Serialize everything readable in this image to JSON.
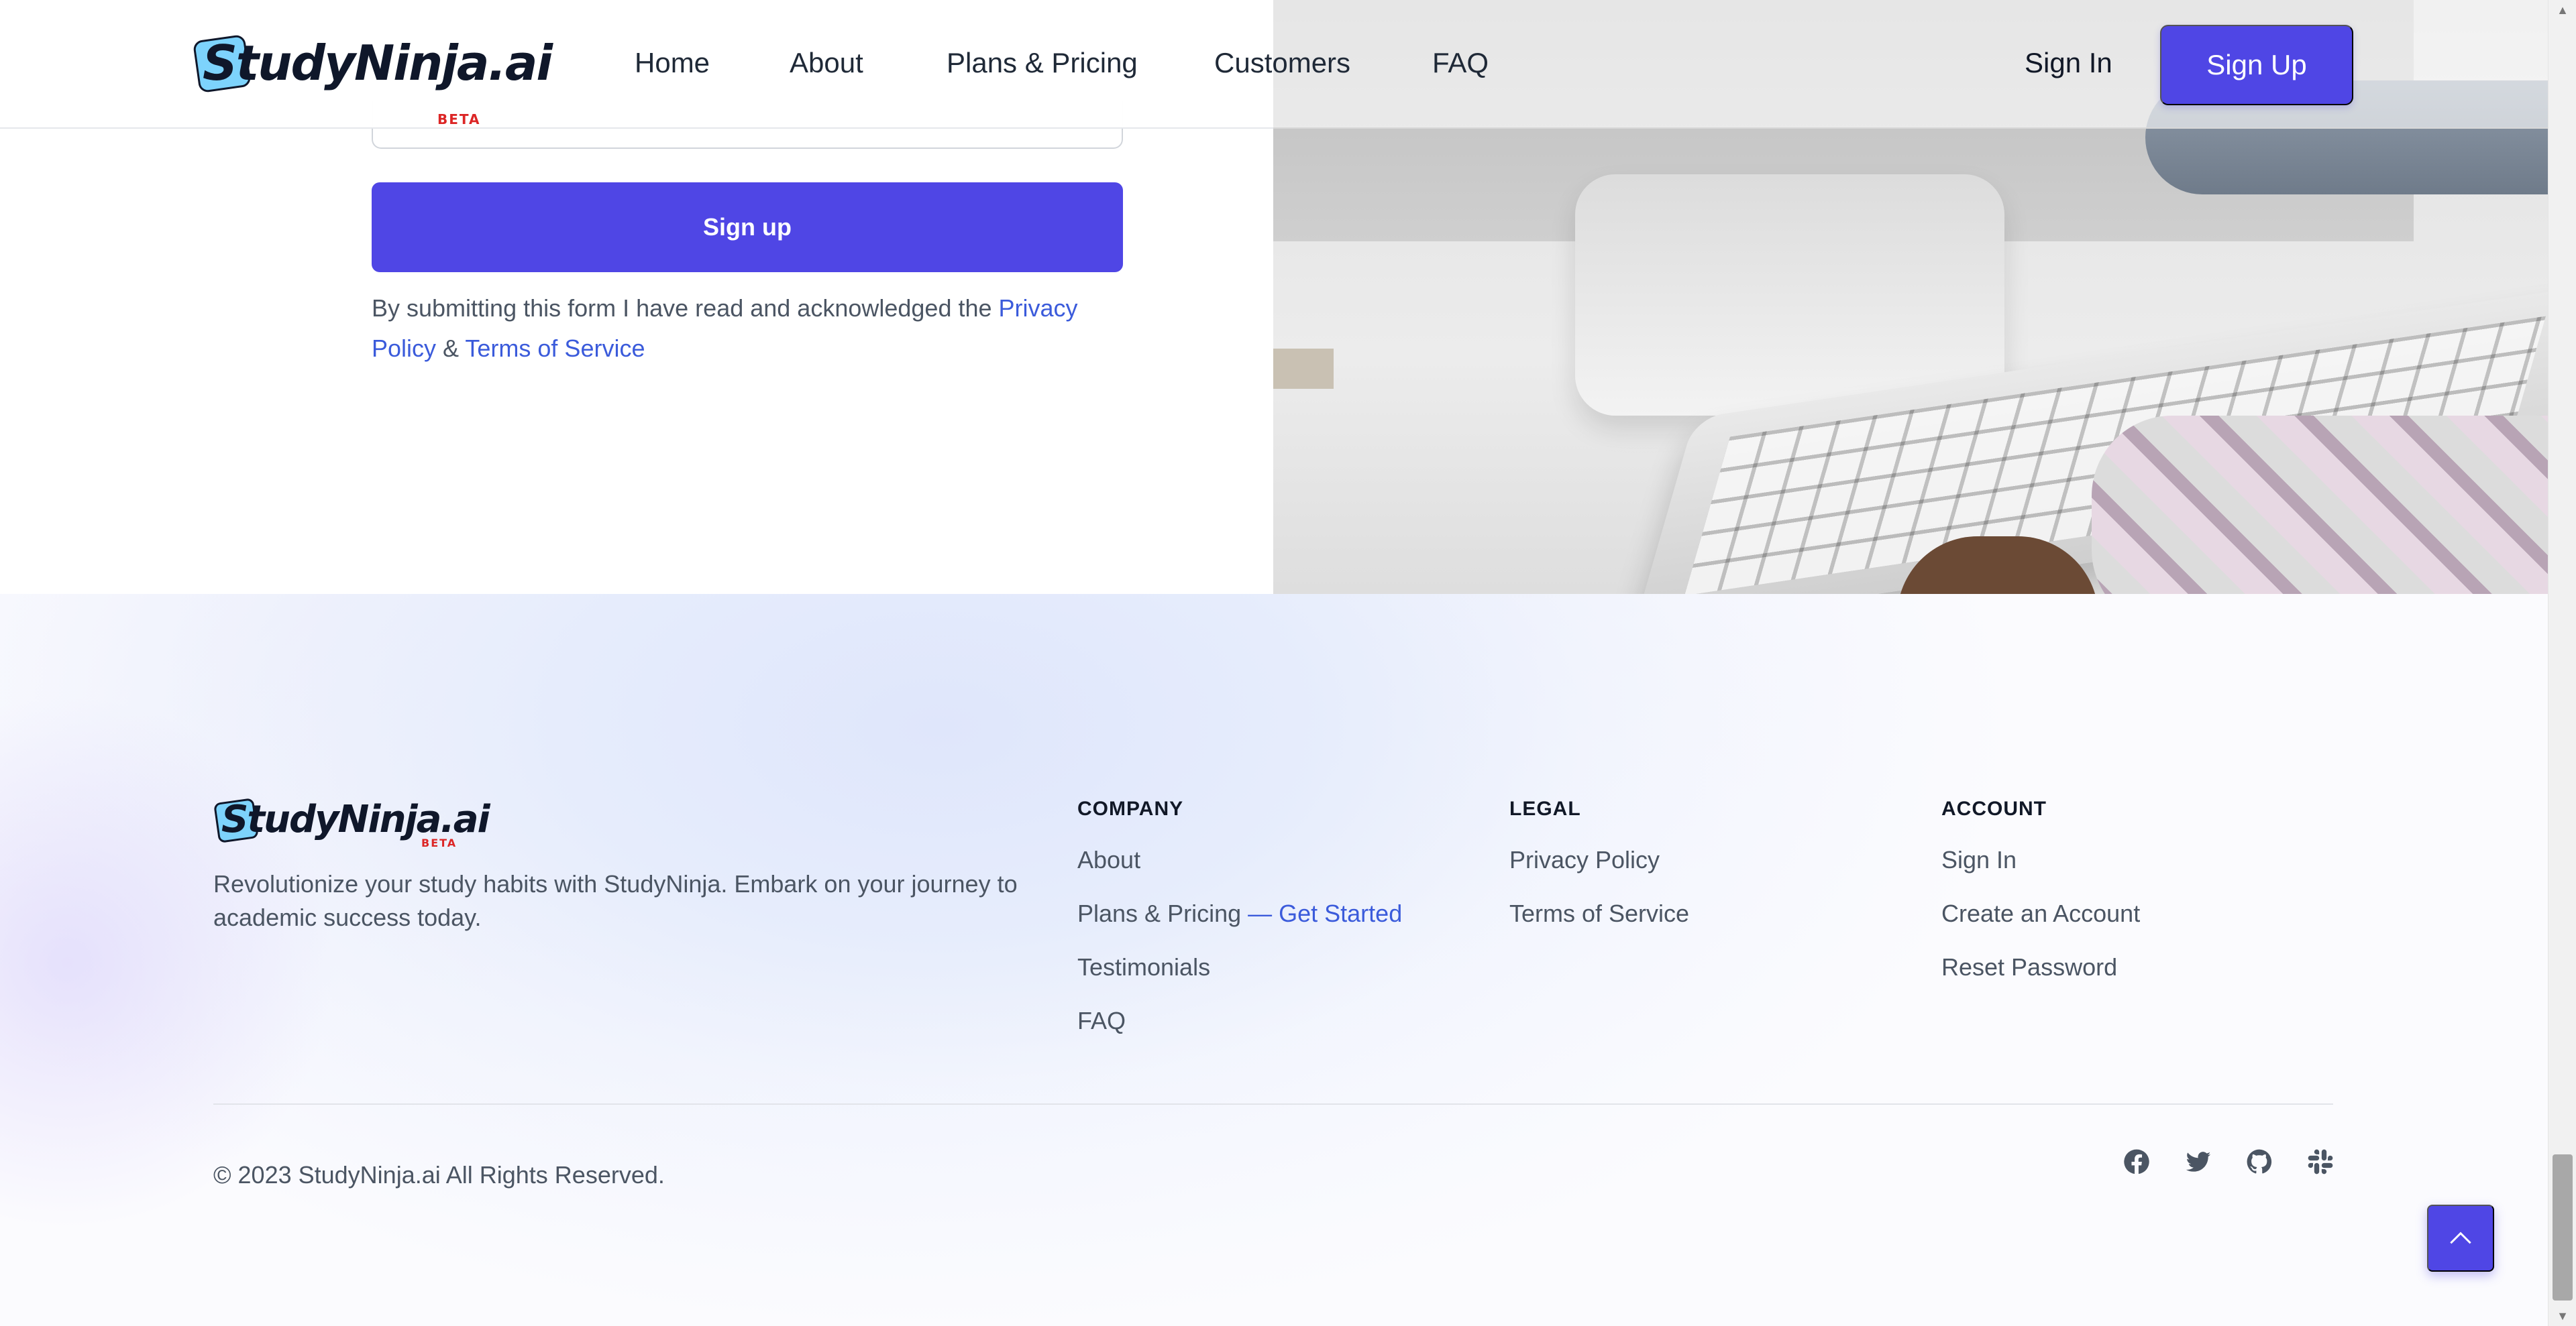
{
  "header": {
    "logo_text": "StudyNinja.ai",
    "logo_badge": "BETA",
    "nav": [
      "Home",
      "About",
      "Plans & Pricing",
      "Customers",
      "FAQ"
    ],
    "sign_in": "Sign In",
    "sign_up": "Sign Up"
  },
  "signup_form": {
    "submit_label": "Sign up",
    "disclaimer_prefix": "By submitting this form I have read and acknowledged the ",
    "privacy_link": "Privacy Policy",
    "and": " & ",
    "terms_link": "Terms of Service"
  },
  "footer": {
    "logo_text": "StudyNinja.ai",
    "logo_badge": "BETA",
    "tagline": "Revolutionize your study habits with StudyNinja. Embark on your journey to academic success today.",
    "company": {
      "title": "COMPANY",
      "about": "About",
      "plans": "Plans & Pricing",
      "plans_accent": " — Get Started",
      "testimonials": "Testimonials",
      "faq": "FAQ"
    },
    "legal": {
      "title": "LEGAL",
      "privacy": "Privacy Policy",
      "terms": "Terms of Service"
    },
    "account": {
      "title": "ACCOUNT",
      "sign_in": "Sign In",
      "create": "Create an Account",
      "reset": "Reset Password"
    },
    "copyright": "© 2023 StudyNinja.ai All Rights Reserved.",
    "social_icons": [
      "facebook-icon",
      "twitter-icon",
      "github-icon",
      "slack-icon"
    ]
  },
  "colors": {
    "primary": "#4f46e5",
    "link": "#3b5bdb",
    "beta": "#dc2626",
    "logo_box": "#7dd3fc"
  }
}
